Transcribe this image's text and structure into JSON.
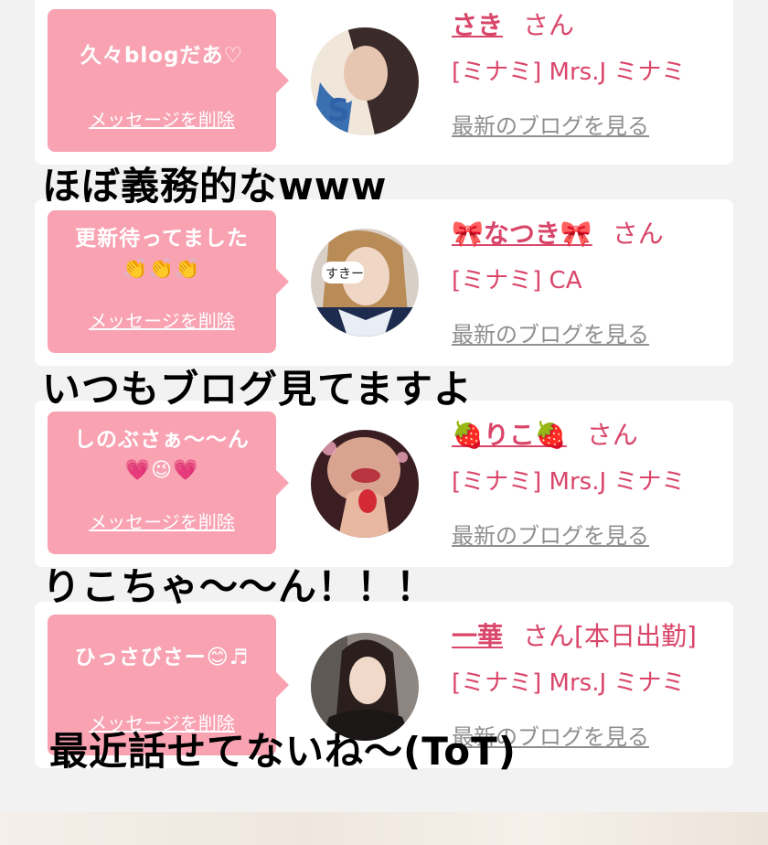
{
  "delete_label": "メッセージを削除",
  "blog_label": "最新のブログを見る",
  "honorific": "さん",
  "cards": [
    {
      "message": "久々blogだあ♡",
      "emoji": "",
      "name": "さき",
      "status": "",
      "shop": "[ミナミ] Mrs.J ミナミ",
      "overlay": "ほぼ義務的なwww"
    },
    {
      "message": "更新待ってました",
      "emoji": "👏👏👏",
      "name": "🎀なつき🎀",
      "status": "",
      "shop": "[ミナミ] CA",
      "overlay": "いつもブログ見てますよ"
    },
    {
      "message": "しのぶさぁ〜〜ん",
      "emoji": "💗😉💗",
      "name": "🍓りこ🍓",
      "status": "",
      "shop": "[ミナミ] Mrs.J ミナミ",
      "overlay": "りこちゃ〜〜ん！！！"
    },
    {
      "message": "ひっさびさー😊♬",
      "emoji": "",
      "name": "一華",
      "status": "[本日出勤]",
      "shop": "[ミナミ] Mrs.J ミナミ",
      "overlay": "最近話せてないね〜(ToT)"
    }
  ]
}
